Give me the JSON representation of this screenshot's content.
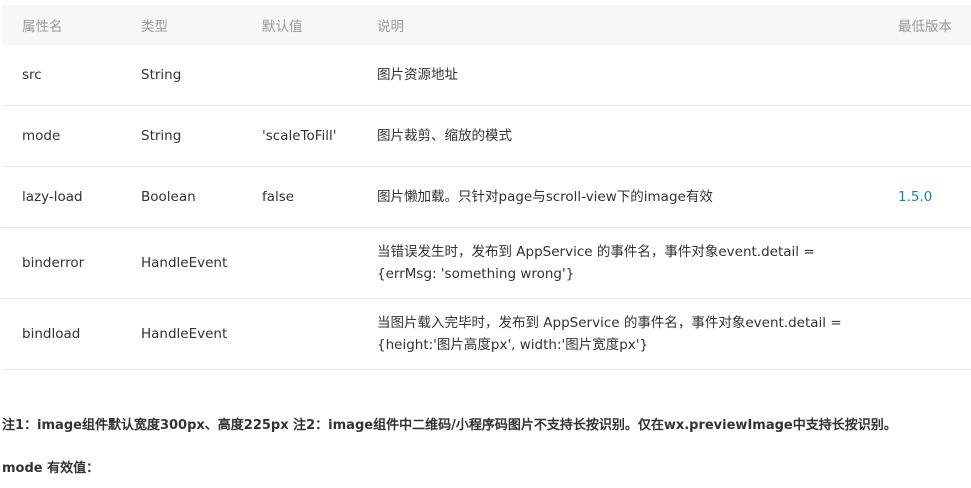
{
  "headers": {
    "name": "属性名",
    "type": "类型",
    "default": "默认值",
    "desc": "说明",
    "version": "最低版本"
  },
  "rows": [
    {
      "name": "src",
      "type": "String",
      "default": "",
      "desc": "图片资源地址",
      "desc2": "",
      "version": ""
    },
    {
      "name": "mode",
      "type": "String",
      "default": "'scaleToFill'",
      "desc": "图片裁剪、缩放的模式",
      "desc2": "",
      "version": ""
    },
    {
      "name": "lazy-load",
      "type": "Boolean",
      "default": "false",
      "desc": "图片懒加载。只针对page与scroll-view下的image有效",
      "desc2": "",
      "version": "1.5.0"
    },
    {
      "name": "binderror",
      "type": "HandleEvent",
      "default": "",
      "desc": "当错误发生时，发布到 AppService 的事件名，事件对象event.detail =",
      "desc2": "{errMsg: 'something wrong'}",
      "version": ""
    },
    {
      "name": "bindload",
      "type": "HandleEvent",
      "default": "",
      "desc": "当图片载入完毕时，发布到 AppService 的事件名，事件对象event.detail =",
      "desc2": "{height:'图片高度px', width:'图片宽度px'}",
      "version": ""
    }
  ],
  "note": "注1：image组件默认宽度300px、高度225px 注2：image组件中二维码/小程序码图片不支持长按识别。仅在wx.previewImage中支持长按识别。",
  "mode_heading": "mode 有效值：",
  "colors": {
    "header_bg": "#f7f7f7",
    "header_text": "#999999",
    "link": "#1a7fc1",
    "border": "#e5e5e5"
  }
}
